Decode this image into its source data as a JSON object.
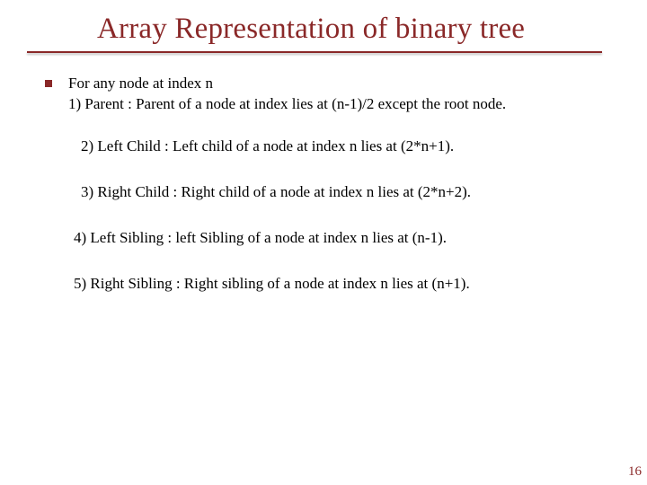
{
  "title": "Array Representation of binary tree",
  "lead": {
    "line1": "For any node at index n",
    "line2": "1) Parent : Parent of a node at index lies at (n-1)/2 except the root node."
  },
  "rules": {
    "r2": "2) Left Child : Left child of a node at index n lies at (2*n+1).",
    "r3": "3) Right Child : Right child of a node at index n lies at (2*n+2).",
    "r4": "4) Left Sibling : left Sibling of a node at index n lies at (n-1).",
    "r5": "5) Right Sibling : Right sibling of a node at index n lies at (n+1)."
  },
  "page_number": "16"
}
